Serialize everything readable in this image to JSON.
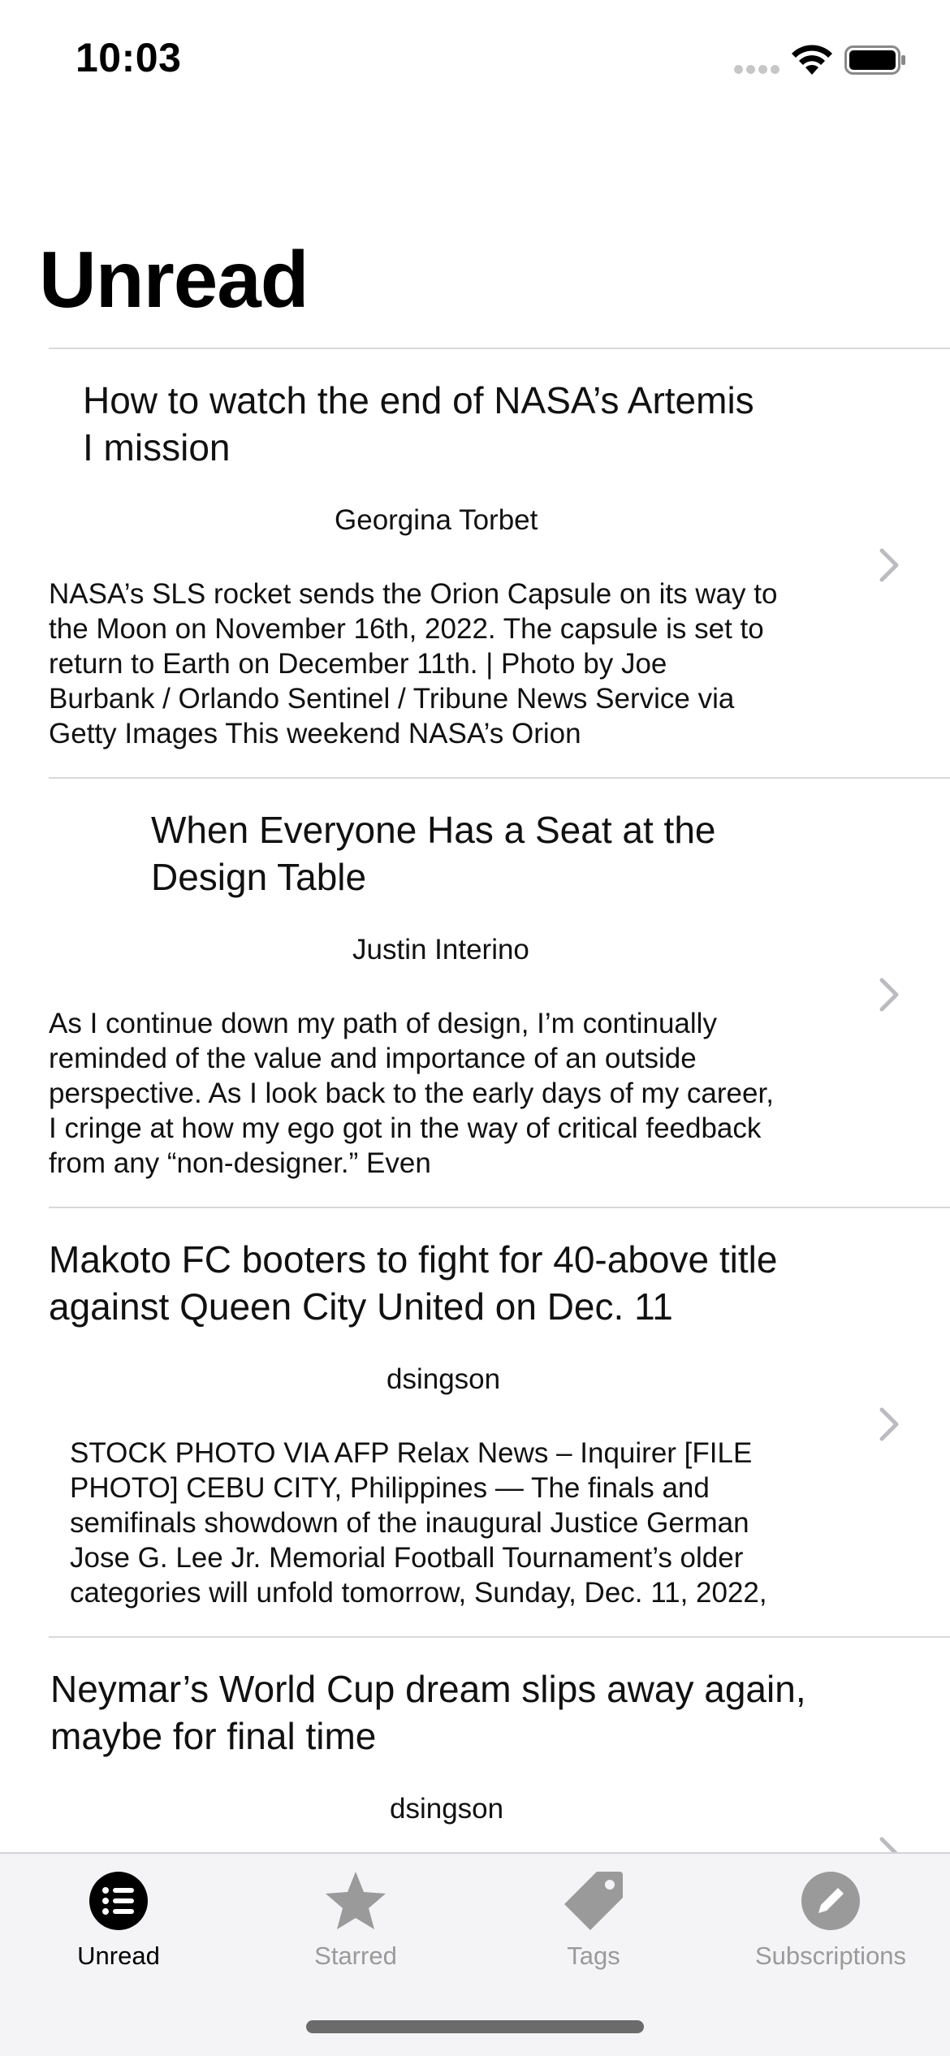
{
  "status": {
    "time": "10:03"
  },
  "header": {
    "title": "Unread"
  },
  "articles": [
    {
      "title_lines": [
        "How to watch the end of NASA’s Artemis",
        "I mission"
      ],
      "author": "Georgina Torbet",
      "summary_lines": [
        "NASA’s SLS rocket sends the Orion Capsule on its way to",
        "the Moon on November 16th, 2022. The capsule is set to",
        "return to Earth on December 11th. | Photo by Joe",
        "Burbank / Orlando Sentinel / Tribune News Service via",
        "Getty Images This weekend NASA’s Orion"
      ]
    },
    {
      "title_lines": [
        "When Everyone Has a Seat at the",
        "Design Table"
      ],
      "author": "Justin Interino",
      "summary_lines": [
        "As I continue down my path of design, I’m continually",
        "reminded of the value and importance of an outside",
        "perspective. As I look back to the early days of my career,",
        "I cringe at how my ego got in the way of critical feedback",
        "from any “non-designer.” Even"
      ]
    },
    {
      "title_lines": [
        "Makoto FC booters to fight for 40-above title",
        "against Queen City United on Dec. 11"
      ],
      "author": "dsingson",
      "summary_lines": [
        "STOCK PHOTO VIA AFP Relax News – Inquirer [FILE",
        "PHOTO] CEBU CITY, Philippines — The finals and",
        "semifinals showdown of the inaugural Justice German",
        "Jose G. Lee Jr. Memorial Football Tournament’s older",
        "categories will unfold tomorrow, Sunday, Dec. 11, 2022,"
      ]
    },
    {
      "title_lines": [
        "Neymar’s World Cup dream slips away again,",
        "maybe for final time"
      ],
      "author": "dsingson",
      "summary_lines": []
    }
  ],
  "tabs": [
    {
      "label": "Unread",
      "icon": "list-bullet-circle-icon",
      "active": true
    },
    {
      "label": "Starred",
      "icon": "star-icon",
      "active": false
    },
    {
      "label": "Tags",
      "icon": "tag-icon",
      "active": false
    },
    {
      "label": "Subscriptions",
      "icon": "pencil-circle-icon",
      "active": false
    }
  ],
  "colors": {
    "active": "#000000",
    "inactive": "#9a9a9a",
    "separator": "#d8d8dc",
    "tabbar_bg": "#f4f4f6"
  }
}
